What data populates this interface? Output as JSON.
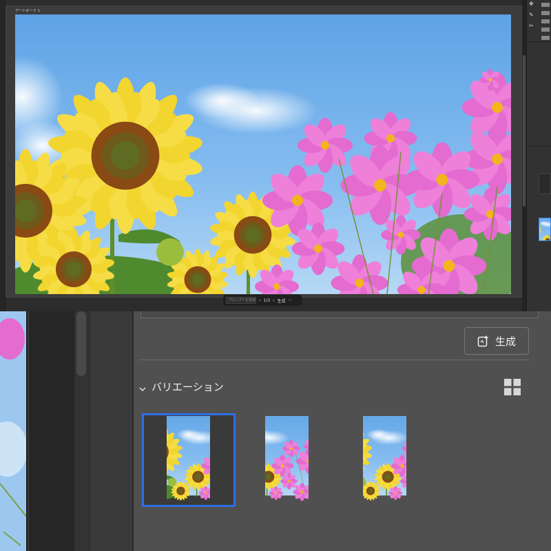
{
  "canvas": {
    "artboard_label": "アートボード 1"
  },
  "taskbar": {
    "prompt_placeholder": "プロンプトを追加",
    "prev": "‹",
    "page": "1/3",
    "next": "›",
    "generate": "生成",
    "more": "···"
  },
  "panel": {
    "generate_button_label": "生成",
    "variations_label": "バリエーション"
  },
  "colors": {
    "selection": "#2f6fe4",
    "panel_bg": "#505050",
    "canvas_bg": "#2c2c2c",
    "sky": "#79b6ee",
    "sunflower": "#f4d73a",
    "cosmos": "#e66fcf"
  },
  "icons": {
    "generate": "sparkle-generate-icon",
    "collapse": "chevron-down-icon",
    "grid": "grid-view-icon"
  }
}
